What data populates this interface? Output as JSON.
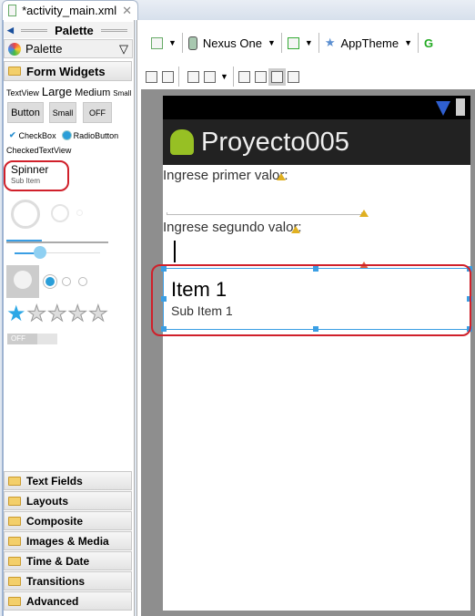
{
  "tab": {
    "title": "*activity_main.xml"
  },
  "palette": {
    "header": "Palette",
    "dropdown": "Palette",
    "open_category": "Form Widgets",
    "widgets": {
      "textview": "TextView",
      "large": "Large",
      "medium": "Medium",
      "small": "Small",
      "button": "Button",
      "small_button": "Small",
      "toggle": "OFF",
      "checkbox": "CheckBox",
      "radiobutton": "RadioButton",
      "checkedtextview": "CheckedTextView",
      "spinner": "Spinner",
      "spinner_sub": "Sub Item",
      "switch": "OFF"
    },
    "categories": [
      "Text Fields",
      "Layouts",
      "Composite",
      "Images & Media",
      "Time & Date",
      "Transitions",
      "Advanced"
    ]
  },
  "toolbar": {
    "device": "Nexus One",
    "theme": "AppTheme"
  },
  "app": {
    "title": "Proyecto005",
    "label1": "Ingrese primer valor:",
    "label2": "Ingrese segundo valor:",
    "item": "Item 1",
    "sub_item": "Sub Item 1"
  },
  "colors": {
    "accent": "#3a9ee4",
    "highlight": "#d0202a"
  }
}
